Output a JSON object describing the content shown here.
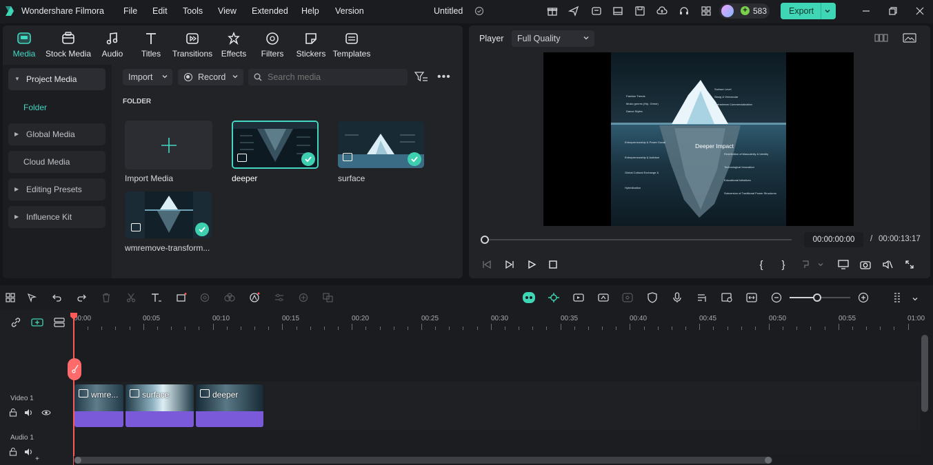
{
  "app": {
    "title": "Wondershare Filmora",
    "project_name": "Untitled",
    "credits": "583",
    "export_label": "Export"
  },
  "menu": [
    "File",
    "Edit",
    "Tools",
    "View",
    "Extended",
    "Help",
    "Version"
  ],
  "categories": [
    {
      "label": "Media",
      "icon": "media-icon",
      "active": true
    },
    {
      "label": "Stock Media",
      "icon": "stock-media-icon"
    },
    {
      "label": "Audio",
      "icon": "audio-icon"
    },
    {
      "label": "Titles",
      "icon": "titles-icon"
    },
    {
      "label": "Transitions",
      "icon": "transitions-icon"
    },
    {
      "label": "Effects",
      "icon": "effects-icon"
    },
    {
      "label": "Filters",
      "icon": "filters-icon"
    },
    {
      "label": "Stickers",
      "icon": "stickers-icon"
    },
    {
      "label": "Templates",
      "icon": "templates-icon"
    }
  ],
  "sidenav": {
    "project_media": "Project Media",
    "folder": "Folder",
    "global_media": "Global Media",
    "cloud_media": "Cloud Media",
    "editing_presets": "Editing Presets",
    "influence_kit": "Influence Kit"
  },
  "media_toolbar": {
    "import_label": "Import",
    "record_label": "Record",
    "search_placeholder": "Search media"
  },
  "media": {
    "folder_heading": "FOLDER",
    "import_tile_label": "Import Media",
    "items": [
      {
        "name": "deeper"
      },
      {
        "name": "surface"
      },
      {
        "name": "wmremove-transform..."
      }
    ]
  },
  "player": {
    "label": "Player",
    "quality": "Full Quality",
    "current_time": "00:00:00:00",
    "separator": "/",
    "total_time": "00:00:13:17",
    "preview": {
      "heading": "Deeper Impact",
      "labels_top": [
        "Surface Level",
        "Fashion Trends",
        "Slang & Vernacular",
        "Music genres (Hip, Grime)",
        "Mainstream Commercialization",
        "Dance Styles"
      ],
      "labels_bottom": [
        "Entrepreneurship & Power Social",
        "Redefinition of Masculinity & Identity",
        "Global Cultural Exchange & Hybridization",
        "Entrepreneurship & Activism",
        "Technological Innovation",
        "Educational Initiatives",
        "Subversion of Traditional Power Structures"
      ]
    }
  },
  "timeline": {
    "ruler": [
      "00:00",
      "00:05",
      "00:10",
      "00:15",
      "00:20",
      "00:25",
      "00:30",
      "00:35",
      "00:40",
      "00:45",
      "00:50",
      "00:55",
      "01:00"
    ],
    "tracks": {
      "video": "Video 1",
      "audio": "Audio 1"
    },
    "clips": [
      {
        "label": "wmre..."
      },
      {
        "label": "surface"
      },
      {
        "label": "deeper"
      }
    ],
    "zoom_level": 0.46
  },
  "colors": {
    "accent": "#43d8c4",
    "export": "#3fd6b6",
    "clip": "#7a5ad8",
    "playhead": "#ff5a5a"
  }
}
